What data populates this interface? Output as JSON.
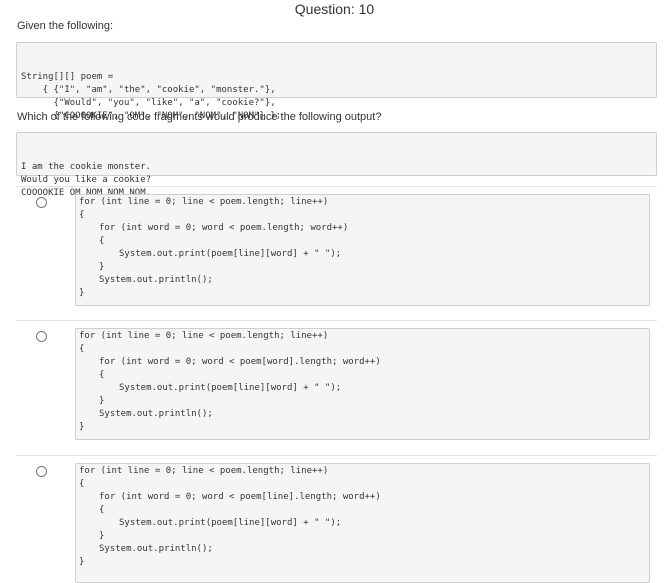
{
  "question_title": "Question: 10",
  "intro": "Given the following:",
  "poem_code": [
    "String[][] poem =",
    "    { {\"I\", \"am\", \"the\", \"cookie\", \"monster.\"},",
    "      {\"Would\", \"you\", \"like\", \"a\", \"cookie?\"},",
    "      {\"COOOOKIE\", \"OM\", \"NOM\", \"NOM\", \"NOM\"} };"
  ],
  "question": "Which of the following code fragments would produce the following output?",
  "output_lines": [
    "I am the cookie monster.",
    "Would you like a cookie?",
    "COOOOKIE OM NOM NOM NOM."
  ],
  "options": [
    {
      "outer": "for (int line = 0; line < poem.length; line++)",
      "open": "{",
      "inner": "for (int word = 0; word < poem.length; word++)",
      "inner_open": "{",
      "print": "System.out.print(poem[line][word] + \" \");",
      "inner_close": "}",
      "println": "System.out.println();",
      "close": "}"
    },
    {
      "outer": "for (int line = 0; line < poem.length; line++)",
      "open": "{",
      "inner": "for (int word = 0; word < poem[word].length; word++)",
      "inner_open": "{",
      "print": "System.out.print(poem[line][word] + \" \");",
      "inner_close": "}",
      "println": "System.out.println();",
      "close": "}"
    },
    {
      "outer": "for (int line = 0; line < poem.length; line++)",
      "open": "{",
      "inner": "for (int word = 0; word < poem[line].length; word++)",
      "inner_open": "{",
      "print": "System.out.print(poem[line][word] + \" \");",
      "inner_close": "}",
      "println": "System.out.println();",
      "close": "}"
    }
  ]
}
